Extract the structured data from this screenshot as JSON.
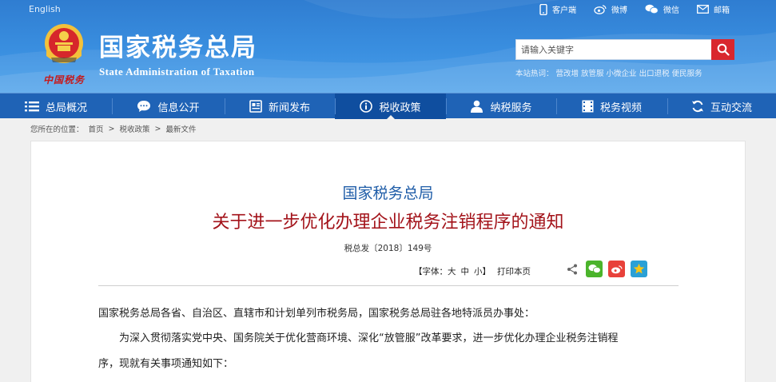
{
  "header": {
    "language_link": "English",
    "top_links": [
      {
        "label": "客户端",
        "icon": "mobile-icon"
      },
      {
        "label": "微博",
        "icon": "weibo-icon"
      },
      {
        "label": "微信",
        "icon": "wechat-icon"
      },
      {
        "label": "邮箱",
        "icon": "mail-icon"
      }
    ],
    "title_cn": "国家税务总局",
    "title_en": "State Administration of Taxation",
    "brush_text": "中国税务",
    "search": {
      "placeholder": "请输入关键字"
    },
    "hot_words": {
      "label": "本站热词：",
      "items": [
        "营改增",
        "放管服",
        "小微企业",
        "出口退税",
        "便民服务"
      ]
    }
  },
  "nav": [
    {
      "label": "总局概况",
      "icon": "list-icon"
    },
    {
      "label": "信息公开",
      "icon": "chat-bubble-icon"
    },
    {
      "label": "新闻发布",
      "icon": "newspaper-icon"
    },
    {
      "label": "税收政策",
      "icon": "info-circle-icon",
      "active": true
    },
    {
      "label": "纳税服务",
      "icon": "user-icon"
    },
    {
      "label": "税务视频",
      "icon": "film-icon"
    },
    {
      "label": "互动交流",
      "icon": "refresh-icon"
    }
  ],
  "breadcrumb": {
    "prefix": "您所在的位置：",
    "items": [
      "首页",
      "税收政策",
      "最新文件"
    ],
    "separator": ">"
  },
  "article": {
    "issuer": "国家税务总局",
    "title": "关于进一步优化办理企业税务注销程序的通知",
    "doc_number": "税总发〔2018〕149号",
    "font_size": {
      "prefix": "【字体：",
      "large": "大",
      "medium": "中",
      "small": "小",
      "suffix": "】"
    },
    "print_label": "打印本页",
    "paragraphs": [
      "国家税务总局各省、自治区、直辖市和计划单列市税务局，国家税务总局驻各地特派员办事处：",
      "为深入贯彻落实党中央、国务院关于优化营商环境、深化“放管服”改革要求，进一步优化办理企业税务注销程",
      "序，现就有关事项通知如下："
    ]
  },
  "colors": {
    "header_blue": "#3a8fe0",
    "nav_blue": "#1f63b6",
    "nav_active": "#0f4e9f",
    "title_red": "#a3131a",
    "issuer_blue": "#1f5da8",
    "search_red": "#d9272e"
  }
}
